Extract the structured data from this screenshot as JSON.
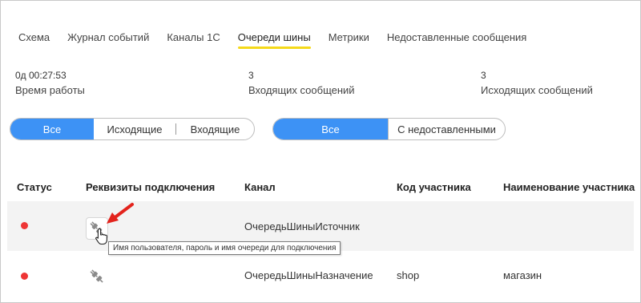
{
  "tabs": [
    {
      "label": "Схема"
    },
    {
      "label": "Журнал событий"
    },
    {
      "label": "Каналы 1С"
    },
    {
      "label": "Очереди шины"
    },
    {
      "label": "Метрики"
    },
    {
      "label": "Недоставленные сообщения"
    }
  ],
  "active_tab": "Очереди шины",
  "stats": [
    {
      "value": "0д 00:27:53",
      "label": "Время работы"
    },
    {
      "value": "3",
      "label": "Входящих сообщений"
    },
    {
      "value": "3",
      "label": "Исходящих сообщений"
    }
  ],
  "direction_filter": {
    "options": [
      "Все",
      "Исходящие",
      "Входящие"
    ],
    "selected": "Все"
  },
  "delivery_filter": {
    "options": [
      "Все",
      "С недоставленными"
    ],
    "selected": "Все"
  },
  "table": {
    "columns": [
      "Статус",
      "Реквизиты подключения",
      "Канал",
      "Код участника",
      "Наименование участника"
    ],
    "rows": [
      {
        "status": "red",
        "channel": "ОчередьШиныИсточник",
        "code": "",
        "name": ""
      },
      {
        "status": "red",
        "channel": "ОчередьШиныНазначение",
        "code": "shop",
        "name": "магазин"
      }
    ]
  },
  "tooltip": "Имя пользователя, пароль и имя очереди для подключения",
  "icons": {
    "connection": "plug-icon",
    "cursor": "hand-cursor-icon",
    "pointer": "red-arrow-icon"
  },
  "colors": {
    "accent": "#3d92f5",
    "tab_underline": "#f5d91a",
    "status_error": "#ee3535",
    "pointer": "#e3231c"
  }
}
